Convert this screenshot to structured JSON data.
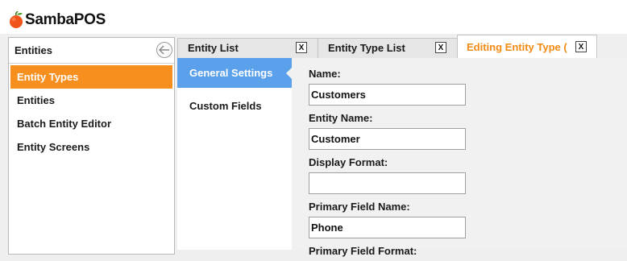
{
  "app": {
    "logo_text": "SambaPOS"
  },
  "left_panel": {
    "title": "Entities",
    "items": [
      {
        "label": "Entity Types"
      },
      {
        "label": "Entities"
      },
      {
        "label": "Batch Entity Editor"
      },
      {
        "label": "Entity Screens"
      }
    ]
  },
  "tabs": [
    {
      "label": "Entity List",
      "close": "X"
    },
    {
      "label": "Entity Type List",
      "close": "X"
    },
    {
      "label": "Editing Entity Type (",
      "close": "X"
    }
  ],
  "subnav": [
    {
      "label": "General Settings"
    },
    {
      "label": "Custom Fields"
    }
  ],
  "form": {
    "name_label": "Name:",
    "name_value": "Customers",
    "entity_name_label": "Entity Name:",
    "entity_name_value": "Customer",
    "display_format_label": "Display Format:",
    "display_format_value": "",
    "primary_field_name_label": "Primary Field Name:",
    "primary_field_name_value": "Phone",
    "primary_field_format_label": "Primary Field Format:"
  },
  "colors": {
    "accent": "#f78f1e",
    "active_subnav": "#5aa0ea",
    "active_tab_text": "#f28a13"
  }
}
